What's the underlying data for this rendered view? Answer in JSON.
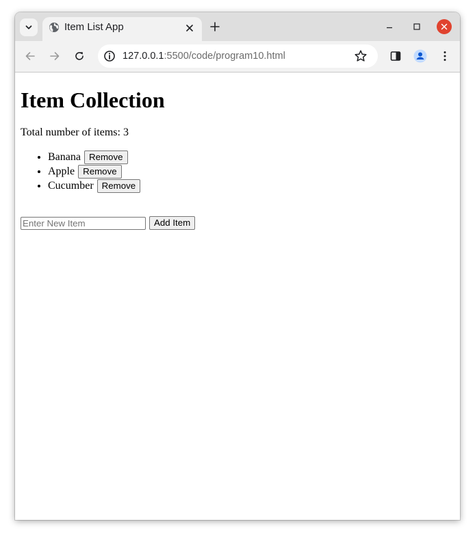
{
  "browser": {
    "tab_title": "Item List App",
    "url_host": "127.0.0.1",
    "url_rest": ":5500/code/program10.html",
    "close_button_color": "#e0432f"
  },
  "page": {
    "heading": "Item Collection",
    "total_text": "Total number of items: 3",
    "items": [
      {
        "name": "Banana",
        "remove_label": "Remove"
      },
      {
        "name": "Apple",
        "remove_label": "Remove"
      },
      {
        "name": "Cucumber",
        "remove_label": "Remove"
      }
    ],
    "new_item_placeholder": "Enter New Item",
    "new_item_value": "",
    "add_button_label": "Add Item"
  }
}
